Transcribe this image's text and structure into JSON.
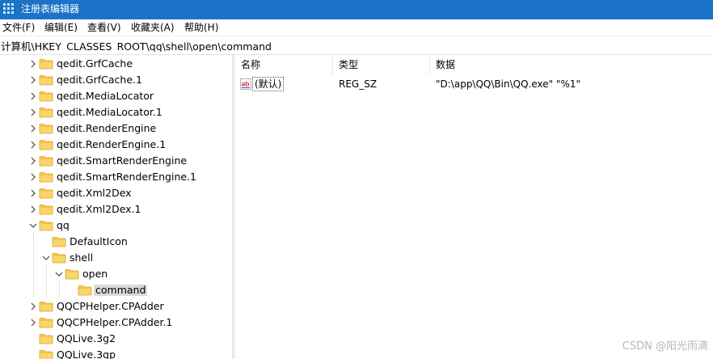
{
  "window": {
    "title": "注册表编辑器"
  },
  "menu": [
    "文件(F)",
    "编辑(E)",
    "查看(V)",
    "收藏夹(A)",
    "帮助(H)"
  ],
  "address": {
    "path": "计算机\\HKEY_CLASSES_ROOT\\qq\\shell\\open\\command"
  },
  "tree": [
    {
      "label": "qedit.GrfCache",
      "expand": "collapsed",
      "level": 0
    },
    {
      "label": "qedit.GrfCache.1",
      "expand": "collapsed",
      "level": 0
    },
    {
      "label": "qedit.MediaLocator",
      "expand": "collapsed",
      "level": 0
    },
    {
      "label": "qedit.MediaLocator.1",
      "expand": "collapsed",
      "level": 0
    },
    {
      "label": "qedit.RenderEngine",
      "expand": "collapsed",
      "level": 0
    },
    {
      "label": "qedit.RenderEngine.1",
      "expand": "collapsed",
      "level": 0
    },
    {
      "label": "qedit.SmartRenderEngine",
      "expand": "collapsed",
      "level": 0
    },
    {
      "label": "qedit.SmartRenderEngine.1",
      "expand": "collapsed",
      "level": 0
    },
    {
      "label": "qedit.Xml2Dex",
      "expand": "collapsed",
      "level": 0
    },
    {
      "label": "qedit.Xml2Dex.1",
      "expand": "collapsed",
      "level": 0
    },
    {
      "label": "qq",
      "expand": "expanded",
      "level": 0
    },
    {
      "label": "DefaultIcon",
      "expand": "none",
      "level": 1
    },
    {
      "label": "shell",
      "expand": "expanded",
      "level": 1
    },
    {
      "label": "open",
      "expand": "expanded",
      "level": 2
    },
    {
      "label": "command",
      "expand": "none",
      "level": 3,
      "selected": true
    },
    {
      "label": "QQCPHelper.CPAdder",
      "expand": "collapsed",
      "level": 0
    },
    {
      "label": "QQCPHelper.CPAdder.1",
      "expand": "collapsed",
      "level": 0
    },
    {
      "label": "QQLive.3g2",
      "expand": "none",
      "level": 0
    },
    {
      "label": "QQLive.3gp",
      "expand": "none",
      "level": 0
    }
  ],
  "columns": [
    "名称",
    "类型",
    "数据"
  ],
  "values": [
    {
      "icon": "string-value-icon",
      "icon_text": "ab",
      "name": "(默认)",
      "type": "REG_SZ",
      "data": "\"D:\\app\\QQ\\Bin\\QQ.exe\" \"%1\""
    }
  ],
  "watermark": "CSDN @阳光雨滴",
  "colors": {
    "titlebar": "#1a73c6",
    "folder": "#f4c54b",
    "selection": "#d9d9d9",
    "ab_red": "#d22b2b"
  }
}
